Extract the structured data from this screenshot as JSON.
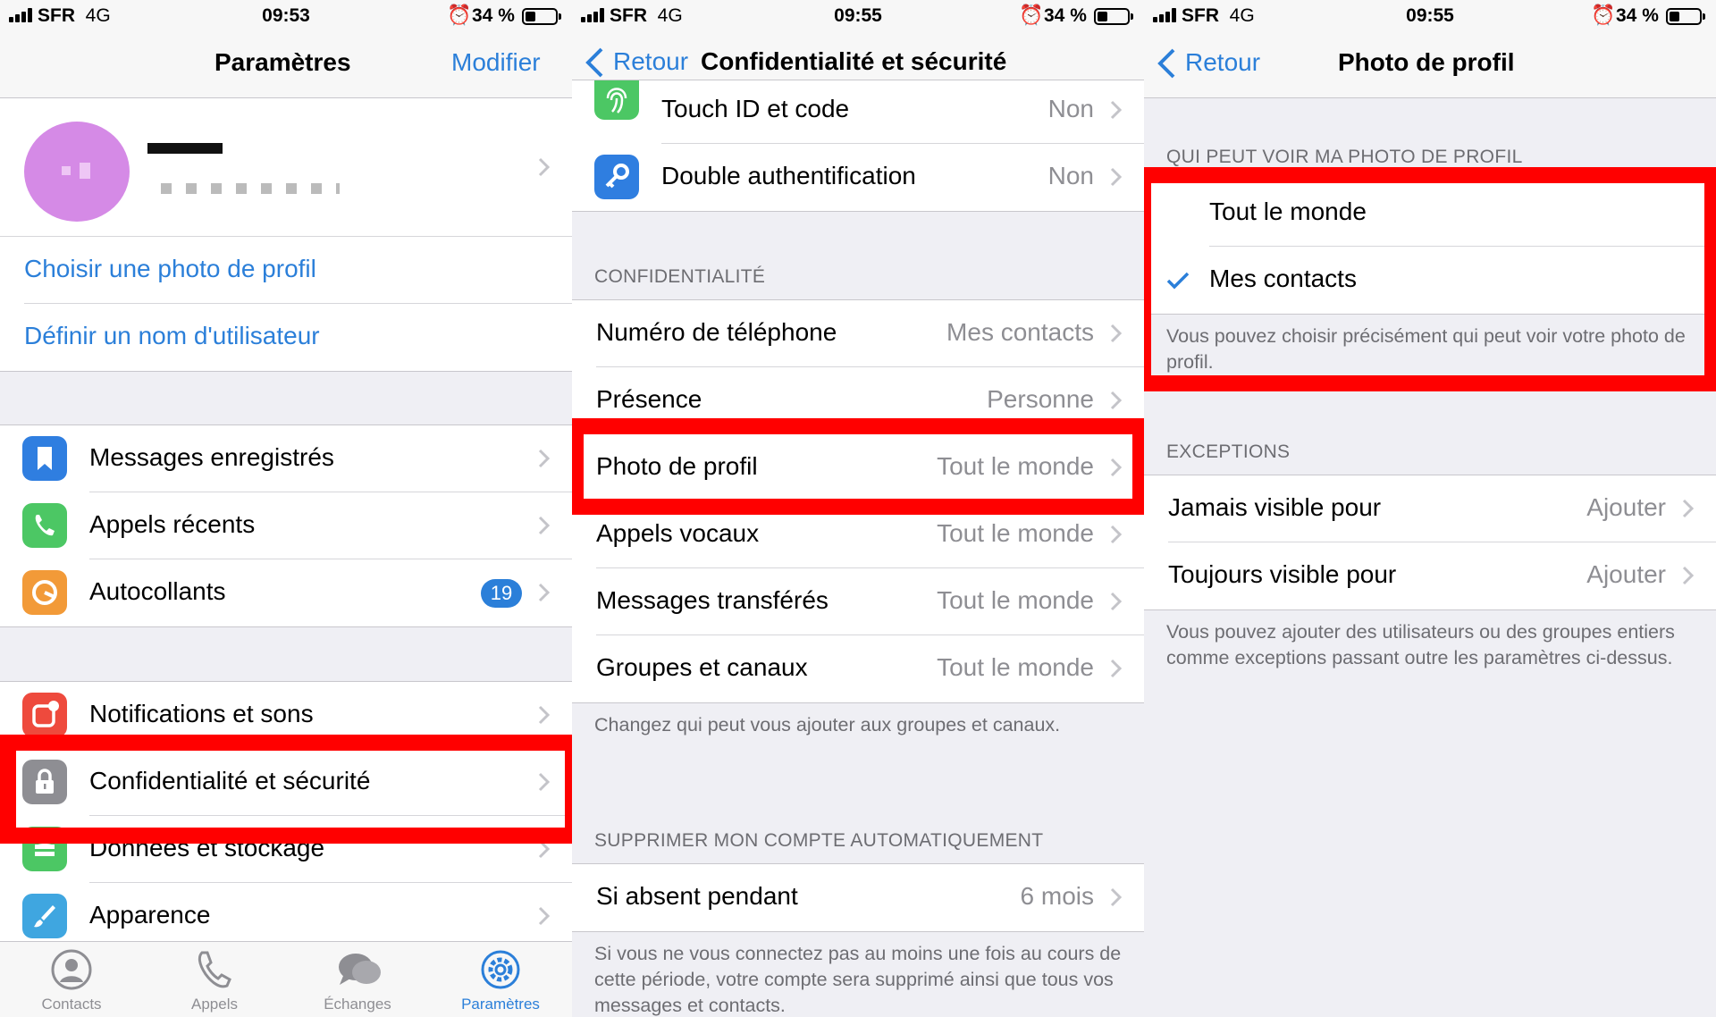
{
  "status_bars": [
    {
      "carrier": "SFR",
      "network": "4G",
      "time": "09:53",
      "battery": "34 %"
    },
    {
      "carrier": "SFR",
      "network": "4G",
      "time": "09:55",
      "battery": "34 %"
    },
    {
      "carrier": "SFR",
      "network": "4G",
      "time": "09:55",
      "battery": "34 %"
    }
  ],
  "colors": {
    "accent": "#2b7fd9",
    "highlight": "#ff0000",
    "background": "#efeff4"
  },
  "settings": {
    "title": "Paramètres",
    "edit": "Modifier",
    "choose_photo": "Choisir une photo de profil",
    "set_username": "Définir un nom d'utilisateur",
    "items": [
      {
        "label": "Messages enregistrés",
        "icon": "bookmark-icon"
      },
      {
        "label": "Appels récents",
        "icon": "phone-icon"
      },
      {
        "label": "Autocollants",
        "icon": "sticker-icon",
        "badge": "19"
      },
      {
        "label": "Notifications et sons",
        "icon": "notification-icon"
      },
      {
        "label": "Confidentialité et sécurité",
        "icon": "lock-icon"
      },
      {
        "label": "Données et stockage",
        "icon": "database-icon"
      },
      {
        "label": "Apparence",
        "icon": "brush-icon"
      }
    ],
    "tabs": [
      {
        "label": "Contacts",
        "icon": "person-icon"
      },
      {
        "label": "Appels",
        "icon": "phone-icon"
      },
      {
        "label": "Échanges",
        "icon": "chat-bubbles-icon"
      },
      {
        "label": "Paramètres",
        "icon": "gear-icon",
        "active": true
      }
    ]
  },
  "privacy": {
    "back": "Retour",
    "title": "Confidentialité et sécurité",
    "security_items": [
      {
        "label": "Touch ID et code",
        "value": "Non",
        "icon": "fingerprint-icon"
      },
      {
        "label": "Double authentification",
        "value": "Non",
        "icon": "key-icon"
      }
    ],
    "privacy_header": "CONFIDENTIALITÉ",
    "privacy_items": [
      {
        "label": "Numéro de téléphone",
        "value": "Mes contacts"
      },
      {
        "label": "Présence",
        "value": "Personne"
      },
      {
        "label": "Photo de profil",
        "value": "Tout le monde"
      },
      {
        "label": "Appels vocaux",
        "value": "Tout le monde"
      },
      {
        "label": "Messages transférés",
        "value": "Tout le monde"
      },
      {
        "label": "Groupes et canaux",
        "value": "Tout le monde"
      }
    ],
    "privacy_footer": "Changez qui peut vous ajouter aux groupes et canaux.",
    "delete_header": "SUPPRIMER MON COMPTE AUTOMATIQUEMENT",
    "delete_item": {
      "label": "Si absent pendant",
      "value": "6 mois"
    },
    "delete_footer": "Si vous ne vous connectez pas au moins une fois au cours de cette période, votre compte sera supprimé ainsi que tous vos messages et contacts."
  },
  "profile_photo": {
    "back": "Retour",
    "title": "Photo de profil",
    "who_header": "QUI PEUT VOIR MA PHOTO DE PROFIL",
    "options": [
      {
        "label": "Tout le monde",
        "selected": false
      },
      {
        "label": "Mes contacts",
        "selected": true
      }
    ],
    "who_footer": "Vous pouvez choisir précisément qui peut voir votre photo de profil.",
    "exceptions_header": "EXCEPTIONS",
    "exceptions": [
      {
        "label": "Jamais visible pour",
        "value": "Ajouter"
      },
      {
        "label": "Toujours visible pour",
        "value": "Ajouter"
      }
    ],
    "exceptions_footer": "Vous pouvez ajouter des utilisateurs ou des groupes entiers comme exceptions passant outre les paramètres ci-dessus."
  }
}
